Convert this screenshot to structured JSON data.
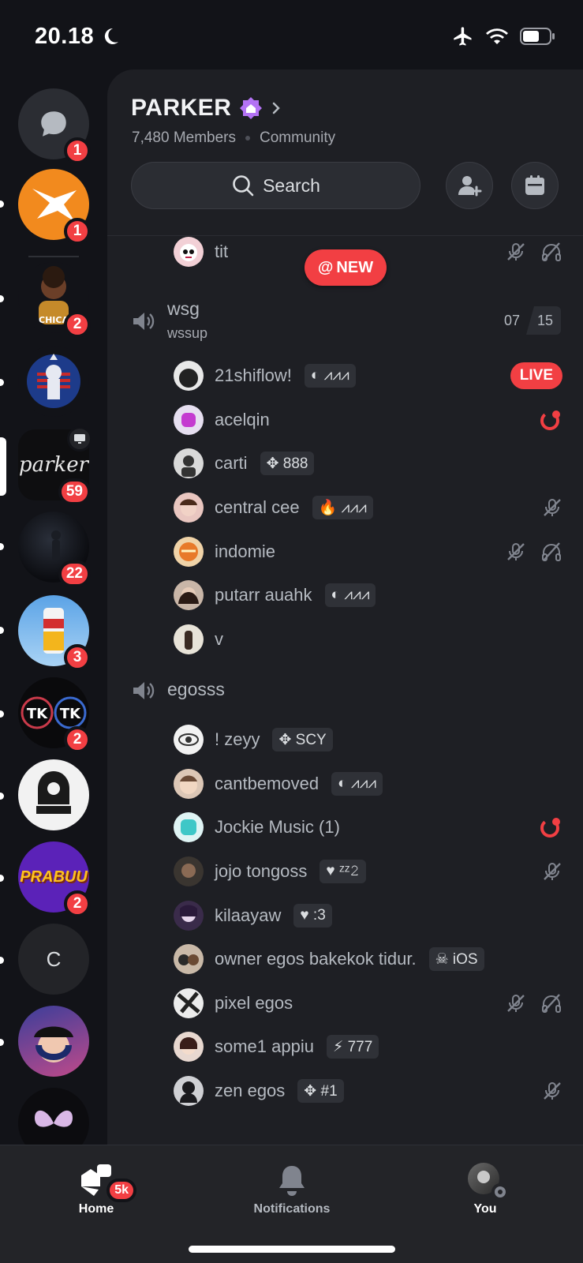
{
  "status": {
    "time": "20.18"
  },
  "guild": {
    "name": "PARKER",
    "members": "7,480 Members",
    "type": "Community",
    "search_label": "Search"
  },
  "colors": {
    "accent_red": "#f23f43",
    "boost_purple": "#b473f5",
    "panel_bg": "#1e1f24"
  },
  "rail": {
    "dm_badge": "1",
    "servers": [
      {
        "badge": "1"
      },
      {
        "badge": "2"
      },
      {
        "badge": ""
      },
      {
        "badge": "59",
        "label": "parker"
      },
      {
        "badge": "22"
      },
      {
        "badge": "3"
      },
      {
        "badge": "2"
      },
      {
        "badge": ""
      },
      {
        "badge": "2",
        "label": "PRABUU"
      },
      {
        "initial": "C"
      }
    ]
  },
  "top_user": {
    "name": "tit"
  },
  "new_pill": "NEW",
  "channels": [
    {
      "name": "wsg",
      "sub": "wssup",
      "count_a": "07",
      "count_b": "15",
      "members": [
        {
          "name": "21shiflow!",
          "tag": "◐ ⩘⩘⩘",
          "live": "LIVE"
        },
        {
          "name": "acelqin"
        },
        {
          "name": "carti",
          "tag": "✥ 888"
        },
        {
          "name": "central cee",
          "tag": "🔥 ⩘⩘⩘"
        },
        {
          "name": "indomie"
        },
        {
          "name": "putarr auahk",
          "tag": "◐ ⩘⩘⩘"
        },
        {
          "name": "v"
        }
      ]
    },
    {
      "name": "egosss",
      "members": [
        {
          "name": "! zeyy",
          "tag": "✥ SCY"
        },
        {
          "name": "cantbemoved",
          "tag": "◐ ⩘⩘⩘"
        },
        {
          "name": "Jockie Music (1)"
        },
        {
          "name": "jojo tongoss",
          "tag": "♥ ᶻᶻ𝟸"
        },
        {
          "name": "kilaayaw",
          "tag": "♥ :3"
        },
        {
          "name": "owner egos bakekok tidur.",
          "tag": "☠ iOS"
        },
        {
          "name": "pixel egos"
        },
        {
          "name": "some1 appiu",
          "tag": "⚡ 777"
        },
        {
          "name": "zen egos",
          "tag": "✥ #1"
        }
      ]
    }
  ],
  "nav": {
    "home": "Home",
    "home_badge": "5k",
    "notifications": "Notifications",
    "you": "You"
  }
}
